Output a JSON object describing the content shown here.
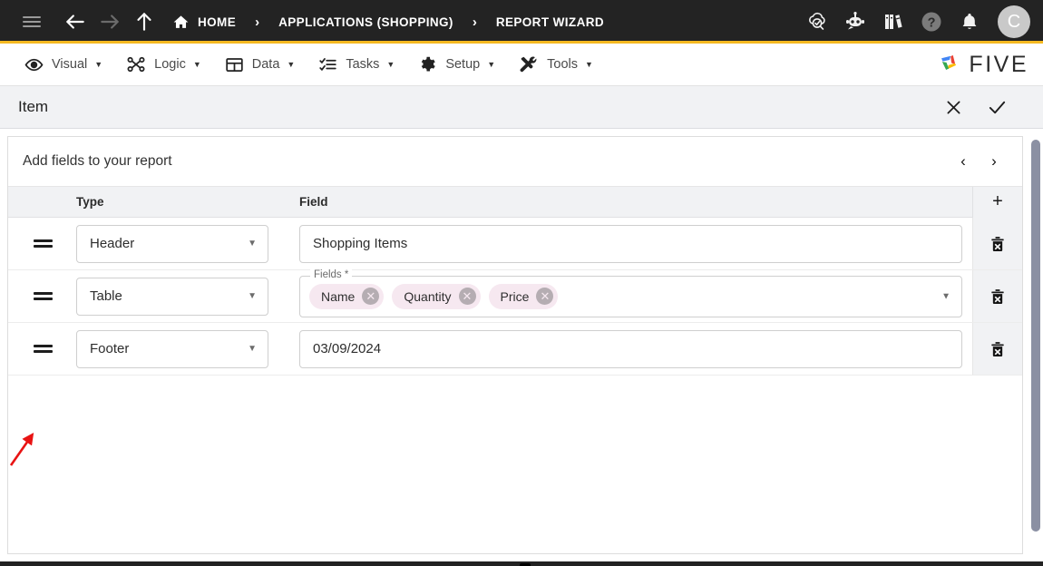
{
  "topbar": {
    "menu_icon": "hamburger-icon",
    "back_icon": "back-arrow-icon",
    "forward_icon": "forward-arrow-icon",
    "up_icon": "up-arrow-icon",
    "breadcrumbs": [
      {
        "label": "HOME",
        "icon": "home-icon"
      },
      {
        "label": "APPLICATIONS (SHOPPING)",
        "icon": ""
      },
      {
        "label": "REPORT WIZARD",
        "icon": ""
      }
    ],
    "separator": "›",
    "actions": [
      {
        "name": "cloud-search-icon"
      },
      {
        "name": "chat-bot-icon"
      },
      {
        "name": "books-icon"
      },
      {
        "name": "help-icon"
      },
      {
        "name": "bell-icon"
      }
    ],
    "avatar_initial": "C",
    "accent_color": "#f5b921",
    "background_color": "#232323"
  },
  "menubar": {
    "items": [
      {
        "label": "Visual",
        "icon": "eye-icon",
        "caret": "▼"
      },
      {
        "label": "Logic",
        "icon": "logic-nodes-icon",
        "caret": "▼"
      },
      {
        "label": "Data",
        "icon": "table-grid-icon",
        "caret": "▼"
      },
      {
        "label": "Tasks",
        "icon": "checklist-icon",
        "caret": "▼"
      },
      {
        "label": "Setup",
        "icon": "gear-icon",
        "caret": "▼"
      },
      {
        "label": "Tools",
        "icon": "tools-icon",
        "caret": "▼"
      }
    ],
    "brand": {
      "text": "FIVE",
      "logo_colors": [
        "#4285f4",
        "#ea4335",
        "#fbbc04",
        "#34a853"
      ]
    }
  },
  "pagebar": {
    "title": "Item",
    "close_label": "✕",
    "confirm_label": "✓"
  },
  "card": {
    "heading": "Add fields to your report",
    "prev_label": "‹",
    "next_label": "›",
    "columns": {
      "type": "Type",
      "field": "Field",
      "add": "+"
    },
    "rows": [
      {
        "handle": "drag-handle",
        "type": "Header",
        "field_kind": "text",
        "field_value": "Shopping Items",
        "delete_icon": "trash-icon"
      },
      {
        "handle": "drag-handle",
        "type": "Table",
        "field_kind": "chips",
        "field_legend": "Fields *",
        "chips": [
          "Name",
          "Quantity",
          "Price"
        ],
        "chip_remove_label": "✕",
        "delete_icon": "trash-icon"
      },
      {
        "handle": "drag-handle",
        "type": "Footer",
        "field_kind": "text",
        "field_value": "03/09/2024",
        "delete_icon": "trash-icon"
      }
    ],
    "select_caret": "▼"
  },
  "annotation": {
    "arrow_color": "#e81313",
    "points_to": "drag-handle-of-table-row"
  }
}
